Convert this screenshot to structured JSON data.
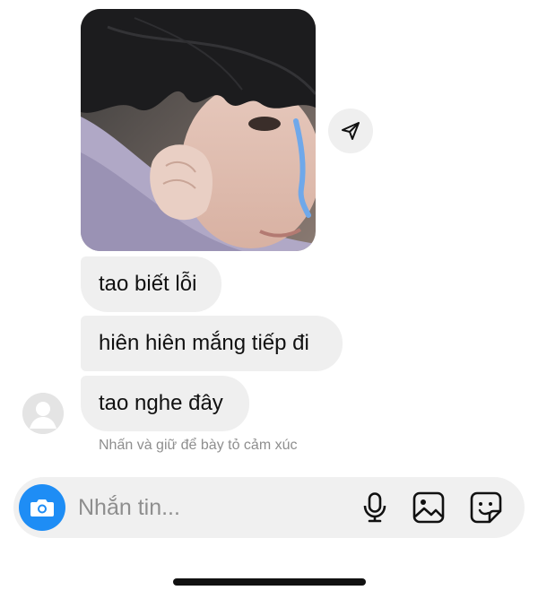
{
  "thread": {
    "photo": {
      "alt": "photo-message",
      "icon": "photo-thumbnail"
    },
    "share_icon": "paper-plane-icon",
    "messages": [
      {
        "text": "tao biết lỗi"
      },
      {
        "text": "hiên hiên mắng tiếp đi"
      },
      {
        "text": "tao nghe đây"
      }
    ],
    "hint": "Nhấn và giữ để bày tỏ cảm xúc"
  },
  "composer": {
    "placeholder": "Nhắn tin...",
    "value": "",
    "icons": [
      "camera-icon",
      "microphone-icon",
      "gallery-icon",
      "sticker-icon"
    ],
    "accent_color": "#1e8df5"
  }
}
